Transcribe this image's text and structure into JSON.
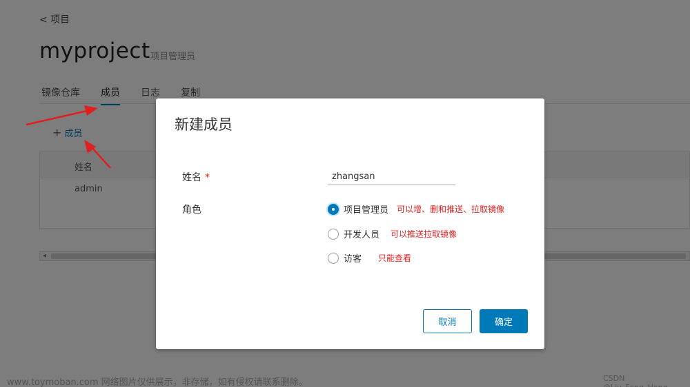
{
  "page": {
    "back_link": "< 项目",
    "project_title": "myproject",
    "project_subtitle": "项目管理员",
    "tabs": [
      {
        "label": "镜像仓库"
      },
      {
        "label": "成员"
      },
      {
        "label": "日志"
      },
      {
        "label": "复制"
      }
    ],
    "add_member_label": "成员",
    "table": {
      "header": "姓名",
      "rows": [
        {
          "name": "admin"
        }
      ]
    }
  },
  "modal": {
    "title": "新建成员",
    "name_label": "姓名",
    "required_mark": "*",
    "name_value": "zhangsan",
    "role_label": "角色",
    "roles": [
      {
        "label": "项目管理员",
        "note": "可以增、删和推送、拉取镜像",
        "checked": true
      },
      {
        "label": "开发人员",
        "note": "可以推送拉取镜像",
        "checked": false
      },
      {
        "label": "访客",
        "note": "只能查看",
        "checked": false
      }
    ],
    "cancel_label": "取消",
    "ok_label": "确定"
  },
  "footer": {
    "watermark": "www.toymoban.com 网络图片仅供展示，非存储，如有侵权请联系删除。",
    "credit": "CSDN @Liu_Feng_Hong"
  },
  "colors": {
    "accent": "#0079b8",
    "annotation": "#e02020",
    "overlay": "rgba(0,0,0,0.5)"
  }
}
